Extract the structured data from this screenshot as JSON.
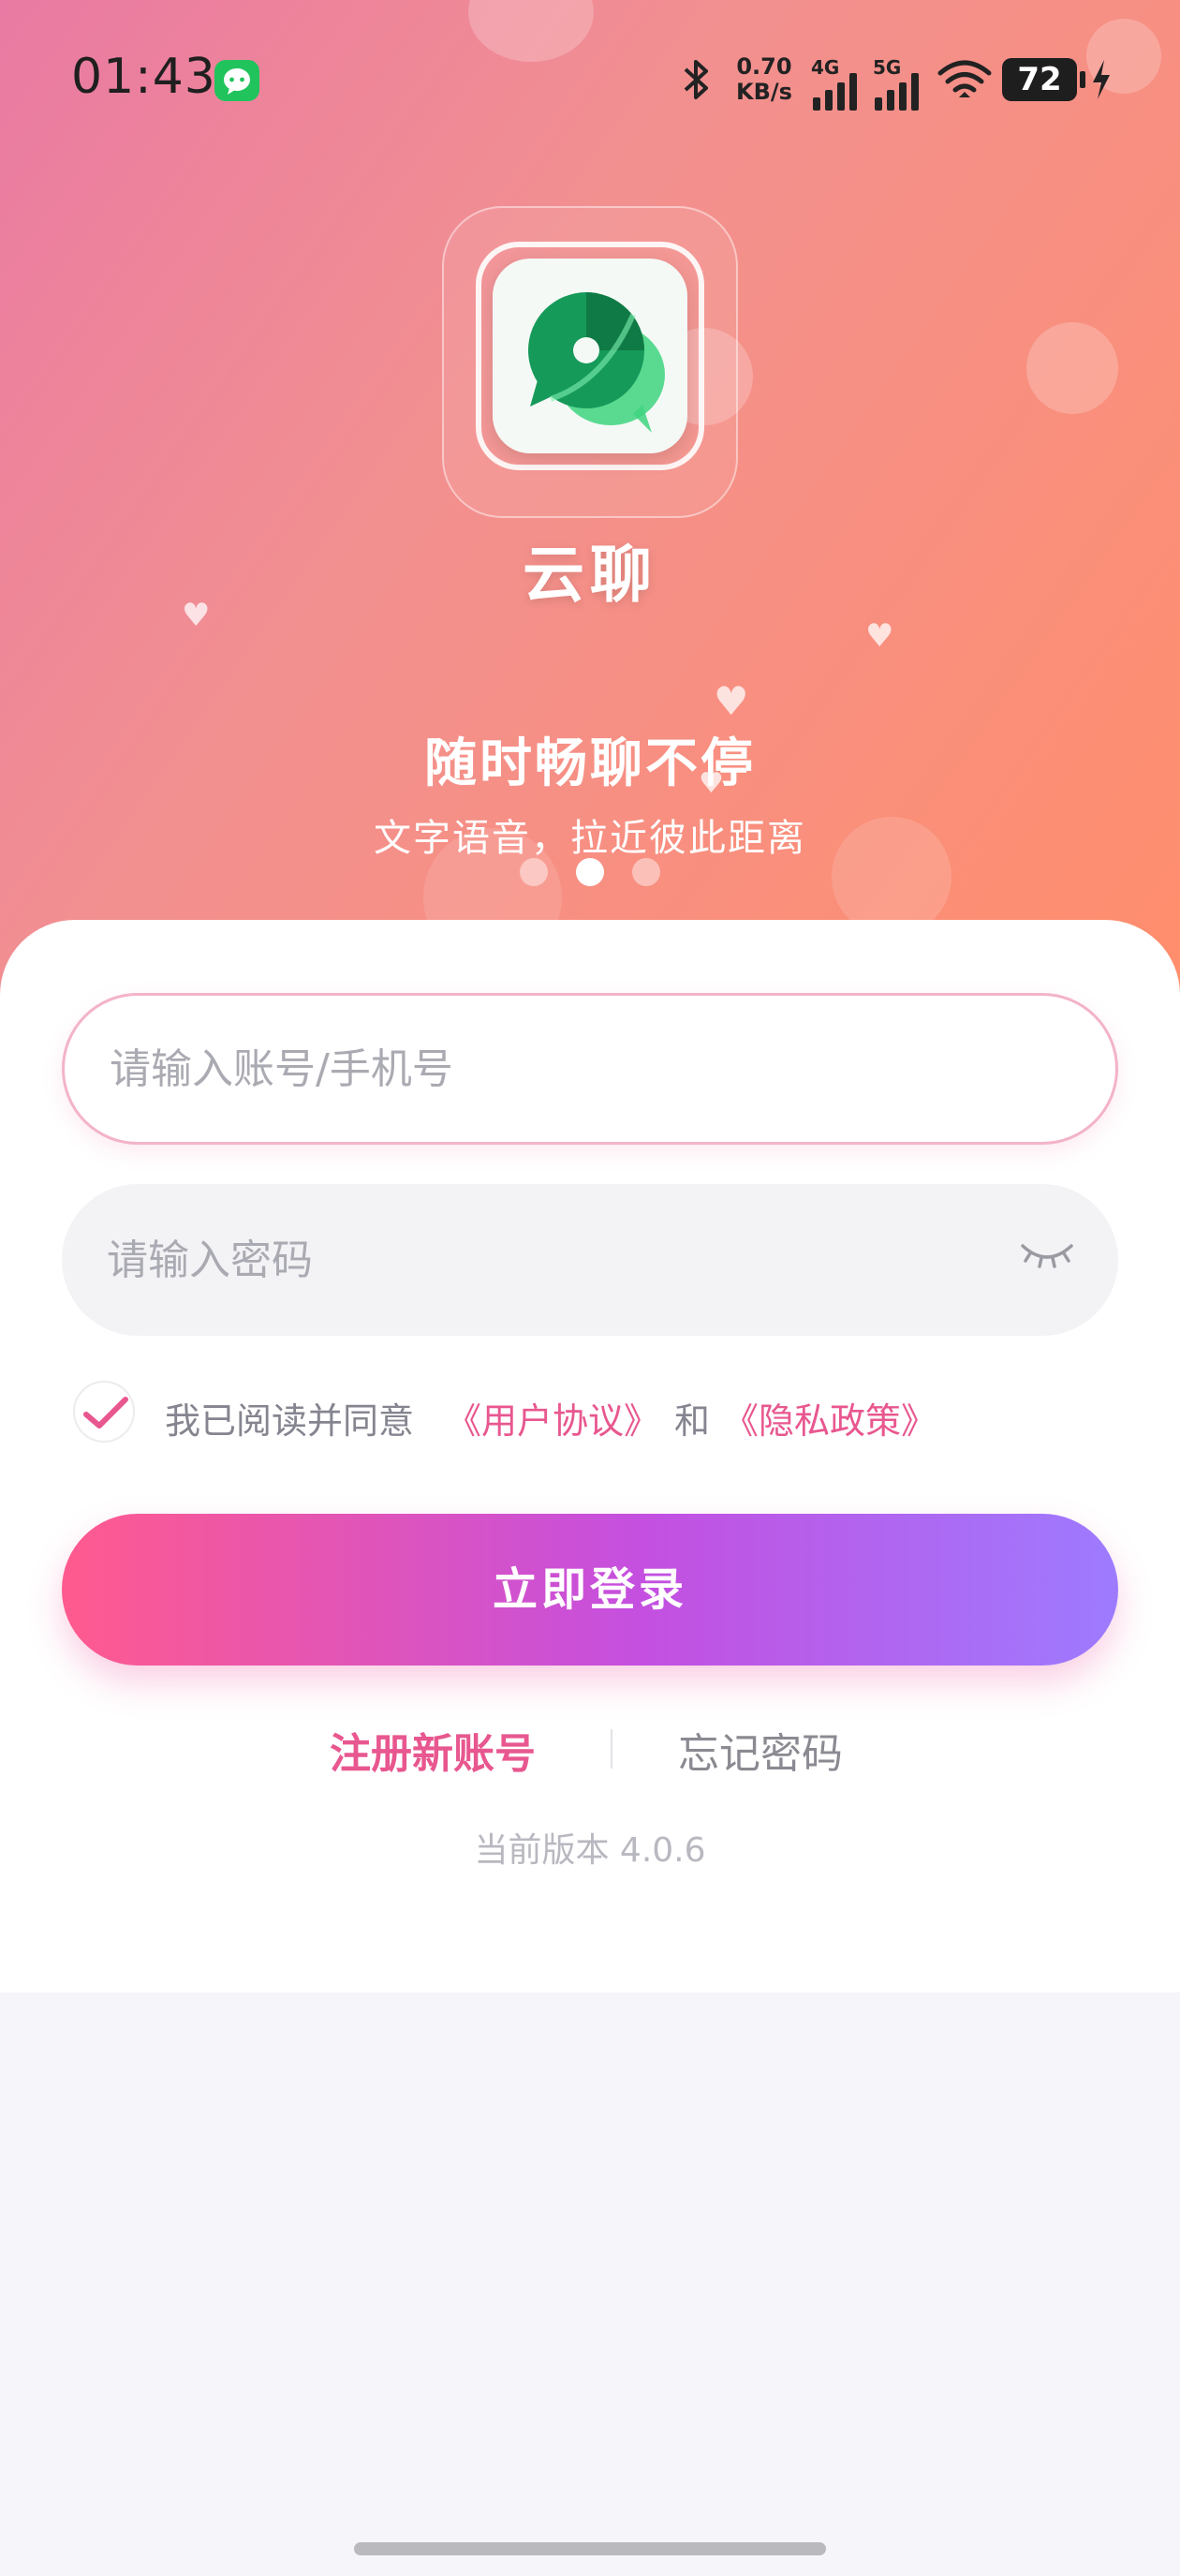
{
  "status_bar": {
    "time": "01:43",
    "net_speed_value": "0.70",
    "net_speed_unit": "KB/s",
    "signal_1_label": "4G",
    "signal_2_label": "5G",
    "battery_level": "72",
    "icons": [
      "message-app-icon",
      "bluetooth-icon",
      "signal-icon",
      "wifi-icon",
      "battery-icon",
      "charging-icon"
    ]
  },
  "app": {
    "name": "云聊",
    "slogan": "随时畅聊不停",
    "subslogan": "文字语音，拉近彼此距离"
  },
  "carousel": {
    "page_count": 3,
    "active_index": 1
  },
  "form": {
    "account_placeholder": "请输入账号/手机号",
    "password_placeholder": "请输入密码",
    "password_visibility_icon": "eye-closed-icon",
    "agreement": {
      "checked": true,
      "prefix": "我已阅读并同意",
      "user_agreement": "《用户协议》",
      "conjunction": "和",
      "privacy_policy": "《隐私政策》"
    },
    "login_label": "立即登录",
    "register_label": "注册新账号",
    "forgot_label": "忘记密码",
    "version_text": "当前版本 4.0.6"
  },
  "colors": {
    "accent_pink": "#e8578f",
    "button_gradient": [
      "#ff5a8e",
      "#c44fe0",
      "#9d7bff"
    ],
    "hero_gradient": [
      "#e97aa3",
      "#f29090",
      "#ff8e6c"
    ]
  }
}
